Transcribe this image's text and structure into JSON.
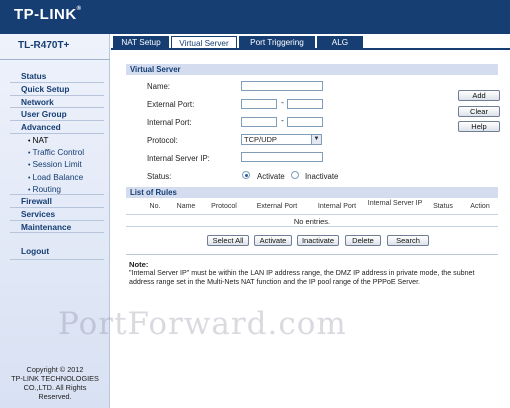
{
  "header": {
    "logo": "TP-LINK",
    "logo_mark": "®"
  },
  "sidebar": {
    "model": "TL-R470T+",
    "items": [
      {
        "label": "Status"
      },
      {
        "label": "Quick Setup"
      },
      {
        "label": "Network"
      },
      {
        "label": "User Group"
      },
      {
        "label": "Advanced"
      }
    ],
    "subitems": [
      {
        "label": "NAT"
      },
      {
        "label": "Traffic Control"
      },
      {
        "label": "Session Limit"
      },
      {
        "label": "Load Balance"
      },
      {
        "label": "Routing"
      }
    ],
    "items2": [
      {
        "label": "Firewall"
      },
      {
        "label": "Services"
      },
      {
        "label": "Maintenance"
      }
    ],
    "logout": "Logout",
    "copyright": [
      "Copyright © 2012",
      "TP-LINK TECHNOLOGIES",
      "CO.,LTD. All Rights",
      "Reserved."
    ]
  },
  "tabs": [
    {
      "label": "NAT Setup"
    },
    {
      "label": "Virtual Server"
    },
    {
      "label": "Port Triggering"
    },
    {
      "label": "ALG"
    }
  ],
  "virtual_server": {
    "title": "Virtual Server",
    "name_label": "Name:",
    "external_port_label": "External Port:",
    "internal_port_label": "Internal Port:",
    "protocol_label": "Protocol:",
    "protocol_value": "TCP/UDP",
    "internal_ip_label": "Internal Server IP:",
    "status_label": "Status:",
    "activate_label": "Activate",
    "inactivate_label": "Inactivate",
    "dash": "-",
    "buttons": {
      "add": "Add",
      "clear": "Clear",
      "help": "Help"
    }
  },
  "rules": {
    "title": "List of Rules",
    "columns": [
      "No.",
      "Name",
      "Protocol",
      "External Port",
      "Internal Port",
      "Internal Server IP",
      "Status",
      "Action"
    ],
    "empty": "No entries.",
    "buttons": {
      "select_all": "Select All",
      "activate": "Activate",
      "inactivate": "Inactivate",
      "delete": "Delete",
      "search": "Search"
    }
  },
  "note": {
    "title": "Note:",
    "text": "\"Internal Server IP\" must be within the LAN IP address range, the DMZ IP address in private mode, the subnet address range set in the Multi-Nets NAT function and the IP pool range of the PPPoE Server."
  },
  "watermark": "PortForward.com",
  "colors": {
    "brand": "#163e73",
    "section": "#d4ddf0"
  }
}
